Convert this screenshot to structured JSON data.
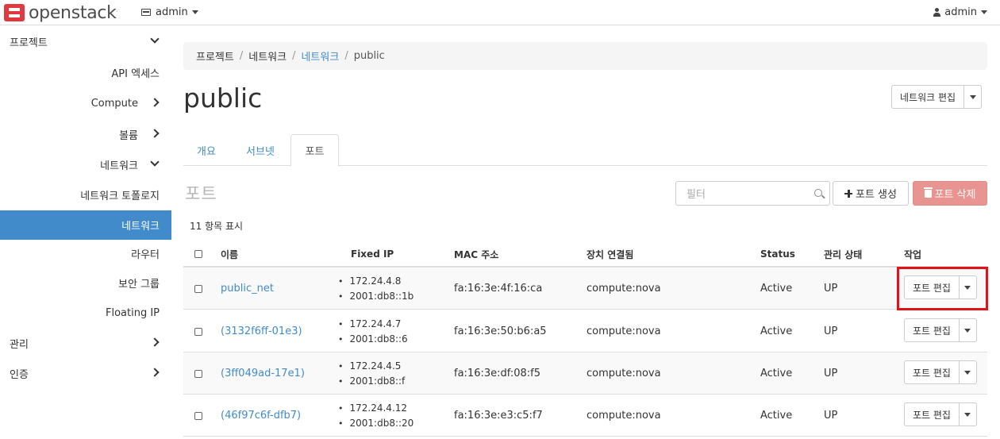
{
  "header": {
    "logo_text": "openstack",
    "logo_tm": ".",
    "project": "admin",
    "user": "admin"
  },
  "sidebar": {
    "project": "프로젝트",
    "api_access": "API 엑세스",
    "compute": "Compute",
    "volume": "볼륨",
    "network": "네트워크",
    "network_topology": "네트워크 토폴로지",
    "networks": "네트워크",
    "routers": "라우터",
    "security_groups": "보안 그룹",
    "floating_ip": "Floating IP",
    "admin": "관리",
    "identity": "인증"
  },
  "breadcrumb": {
    "project": "프로젝트",
    "network": "네트워크",
    "networks": "네트워크",
    "current": "public",
    "sep": "/"
  },
  "page": {
    "title": "public",
    "edit_network": "네트워크 편집"
  },
  "tabs": {
    "overview": "개요",
    "subnets": "서브넷",
    "ports": "포트"
  },
  "ports": {
    "section_title": "포트",
    "filter_placeholder": "필터",
    "create_label": "포트 생성",
    "delete_label": "포트 삭제",
    "count_text": "11 항목 표시",
    "columns": {
      "name": "이름",
      "fixed_ip": "Fixed IP",
      "mac": "MAC 주소",
      "attached": "장치 연결됨",
      "status": "Status",
      "admin_state": "관리 상태",
      "actions": "작업"
    },
    "edit_label": "포트 편집",
    "rows": [
      {
        "name": "public_net",
        "ip1": "172.24.4.8",
        "ip2": "2001:db8::1b",
        "mac": "fa:16:3e:4f:16:ca",
        "attached": "compute:nova",
        "status": "Active",
        "admin_state": "UP"
      },
      {
        "name": "(3132f6ff-01e3)",
        "ip1": "172.24.4.7",
        "ip2": "2001:db8::6",
        "mac": "fa:16:3e:50:b6:a5",
        "attached": "compute:nova",
        "status": "Active",
        "admin_state": "UP"
      },
      {
        "name": "(3ff049ad-17e1)",
        "ip1": "172.24.4.5",
        "ip2": "2001:db8::f",
        "mac": "fa:16:3e:df:08:f5",
        "attached": "compute:nova",
        "status": "Active",
        "admin_state": "UP"
      },
      {
        "name": "(46f97c6f-dfb7)",
        "ip1": "172.24.4.12",
        "ip2": "2001:db8::20",
        "mac": "fa:16:3e:e3:c5:f7",
        "attached": "compute:nova",
        "status": "Active",
        "admin_state": "UP"
      }
    ]
  },
  "colors": {
    "accent": "#428bca",
    "danger": "#e89491",
    "highlight": "#e0131a"
  }
}
